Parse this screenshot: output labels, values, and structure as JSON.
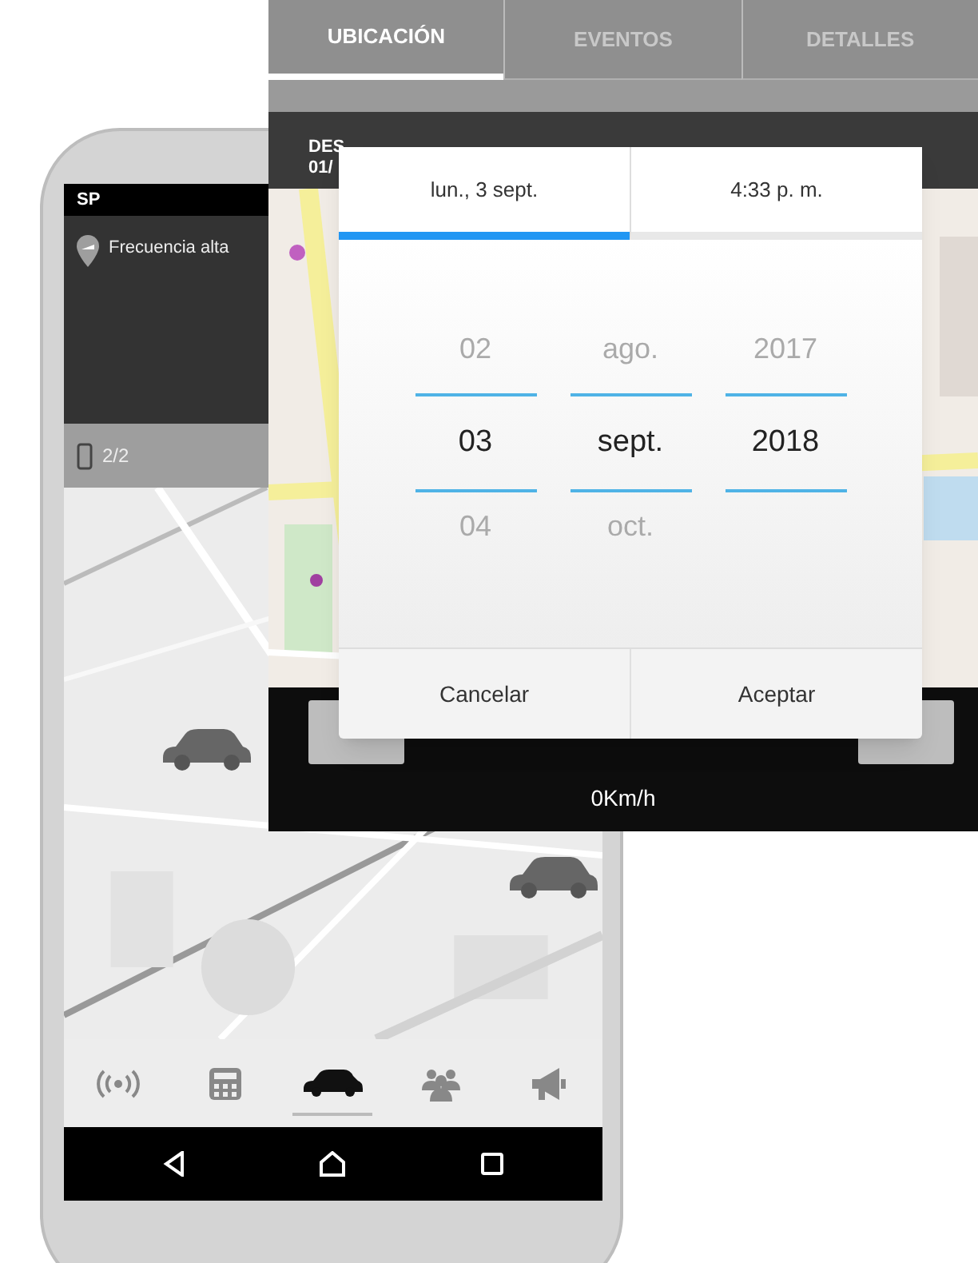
{
  "phone": {
    "status_title": "SP",
    "mode": {
      "label": "Frecuencia alta"
    },
    "device_count": "2/2",
    "map": {
      "kind": "picture"
    },
    "bottom_nav": [
      {
        "selected": false
      },
      {
        "selected": false
      },
      {
        "selected": true
      },
      {
        "selected": false
      },
      {
        "selected": false
      }
    ]
  },
  "detail_panel": {
    "tabs": [
      {
        "label": "UBICACIÓN",
        "selected": true
      },
      {
        "label": "EVENTOS",
        "selected": false
      },
      {
        "label": "DETALLES",
        "selected": false
      }
    ],
    "header_lines": [
      "DES",
      "01/"
    ],
    "map": {
      "kind": "picture"
    },
    "speed": "0Km/h"
  },
  "date_dialog": {
    "tabs": [
      {
        "label": "lun., 3 sept.",
        "selected": true
      },
      {
        "label": "4:33 p. m.",
        "selected": false
      }
    ],
    "columns": [
      {
        "prev": "02",
        "current": "03",
        "next": "04"
      },
      {
        "prev": "ago.",
        "current": "sept.",
        "next": "oct."
      },
      {
        "prev": "2017",
        "current": "2018"
      }
    ],
    "buttons": [
      "Cancelar",
      "Aceptar"
    ]
  }
}
